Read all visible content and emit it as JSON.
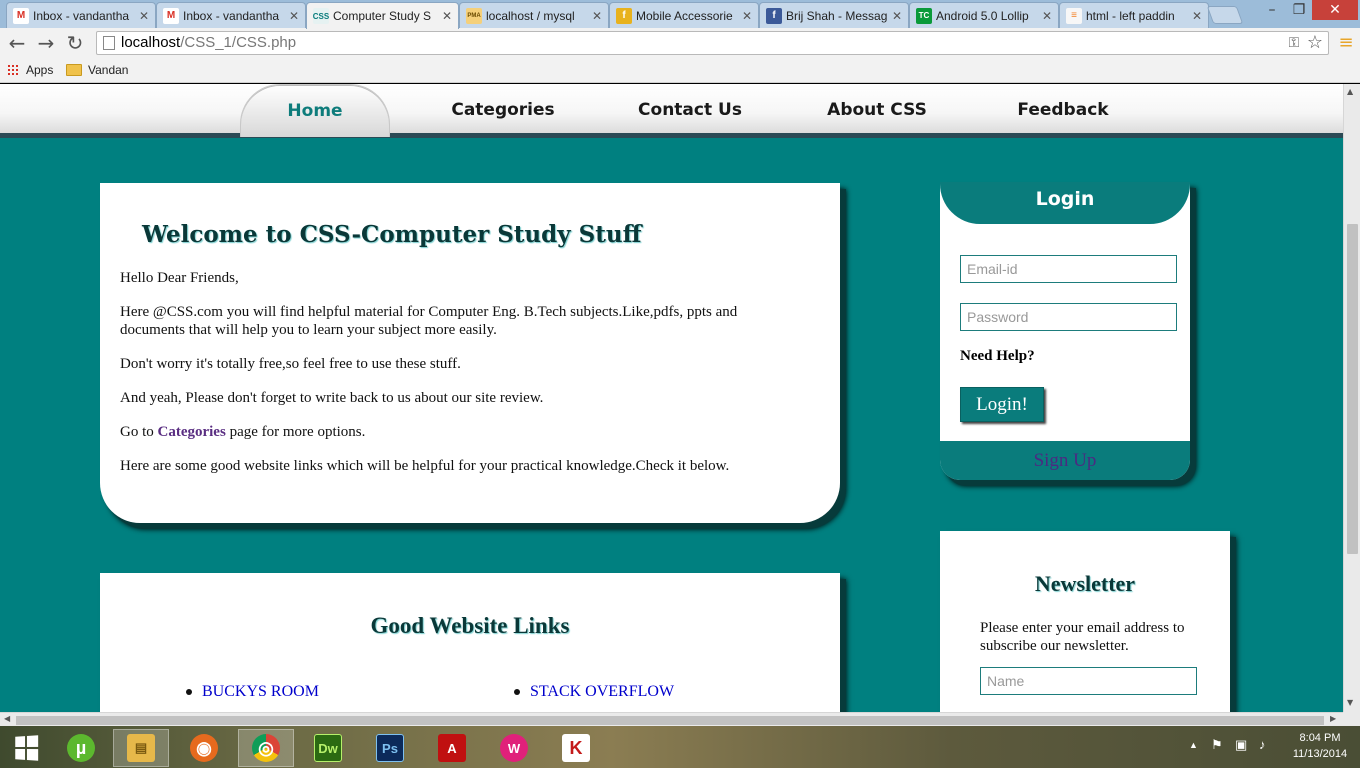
{
  "browser": {
    "tabs": [
      {
        "title": "Inbox - vandantha",
        "icon": "gmail-icon",
        "fav": "M",
        "color": "#ffffff",
        "fg": "#d93025"
      },
      {
        "title": "Inbox - vandantha",
        "icon": "gmail-icon",
        "fav": "M",
        "color": "#ffffff",
        "fg": "#d93025"
      },
      {
        "title": "Computer Study S",
        "icon": "css-site-icon",
        "fav": "CSS",
        "color": "#e6f2f2",
        "fg": "#0a7c7c",
        "active": true
      },
      {
        "title": "localhost / mysql",
        "icon": "phpmyadmin-icon",
        "fav": "PMA",
        "color": "#f5d07a",
        "fg": "#6a4a00"
      },
      {
        "title": "Mobile Accessorie",
        "icon": "shop-icon",
        "fav": "f",
        "color": "#e8b21d",
        "fg": "#ffffff"
      },
      {
        "title": "Brij Shah - Messag",
        "icon": "facebook-icon",
        "fav": "f",
        "color": "#3b5998",
        "fg": "#ffffff"
      },
      {
        "title": "Android 5.0 Lollip",
        "icon": "techcrunch-icon",
        "fav": "TC",
        "color": "#0a9a3a",
        "fg": "#ffffff"
      },
      {
        "title": "html - left paddin",
        "icon": "stackoverflow-icon",
        "fav": "≡",
        "color": "#f7f7f7",
        "fg": "#f48024"
      }
    ],
    "address": {
      "host": "localhost",
      "path": "/CSS_1/CSS.php"
    },
    "bookmarks": [
      {
        "label": "Apps",
        "icon": "apps-grid-icon"
      },
      {
        "label": "Vandan",
        "icon": "folder-icon"
      }
    ]
  },
  "site": {
    "nav": {
      "items": [
        {
          "label": "Home",
          "active": true
        },
        {
          "label": "Categories"
        },
        {
          "label": "Contact Us"
        },
        {
          "label": "About CSS"
        },
        {
          "label": "Feedback"
        }
      ]
    },
    "welcome": {
      "title": "Welcome to CSS-Computer Study Stuff",
      "p1": "Hello Dear Friends,",
      "p2": "Here @CSS.com you will find helpful material for Computer Eng. B.Tech subjects.Like,pdfs, ppts and documents that will help you to learn your subject more easily.",
      "p3": "Don't worry it's totally free,so feel free to use these stuff.",
      "p4": "And yeah, Please don't forget to write back to us about our site review.",
      "p5_pre": "Go to ",
      "p5_link": "Categories",
      "p5_post": " page for more options.",
      "p6": "Here are some good website links which will be helpful for your practical knowledge.Check it below."
    },
    "links": {
      "title": "Good Website Links",
      "items": [
        "BUCKYS ROOM",
        "STACK OVERFLOW"
      ]
    },
    "login": {
      "title": "Login",
      "email_placeholder": "Email-id",
      "password_placeholder": "Password",
      "help": "Need Help?",
      "button": "Login!",
      "signup": "Sign Up"
    },
    "newsletter": {
      "title": "Newsletter",
      "desc": "Please enter your email address to subscribe our newsletter.",
      "name_placeholder": "Name"
    }
  },
  "taskbar": {
    "apps": [
      {
        "name": "utorrent",
        "label": "µ",
        "color": "#5cb82e"
      },
      {
        "name": "file-explorer",
        "label": "▤",
        "color": "#e6b84a"
      },
      {
        "name": "firefox",
        "label": "◉",
        "color": "#e66a1e"
      },
      {
        "name": "chrome",
        "label": "◎",
        "color": "#2e9f48",
        "active": true
      },
      {
        "name": "dreamweaver",
        "label": "Dw",
        "color": "#2b6a12"
      },
      {
        "name": "photoshop",
        "label": "Ps",
        "color": "#0c2a5a"
      },
      {
        "name": "acrobat",
        "label": "A",
        "color": "#c01010"
      },
      {
        "name": "wamp",
        "label": "W",
        "color": "#e0217a"
      },
      {
        "name": "kaspersky",
        "label": "K",
        "color": "#c41a1a"
      }
    ],
    "clock": {
      "time": "8:04 PM",
      "date": "11/13/2014"
    }
  }
}
